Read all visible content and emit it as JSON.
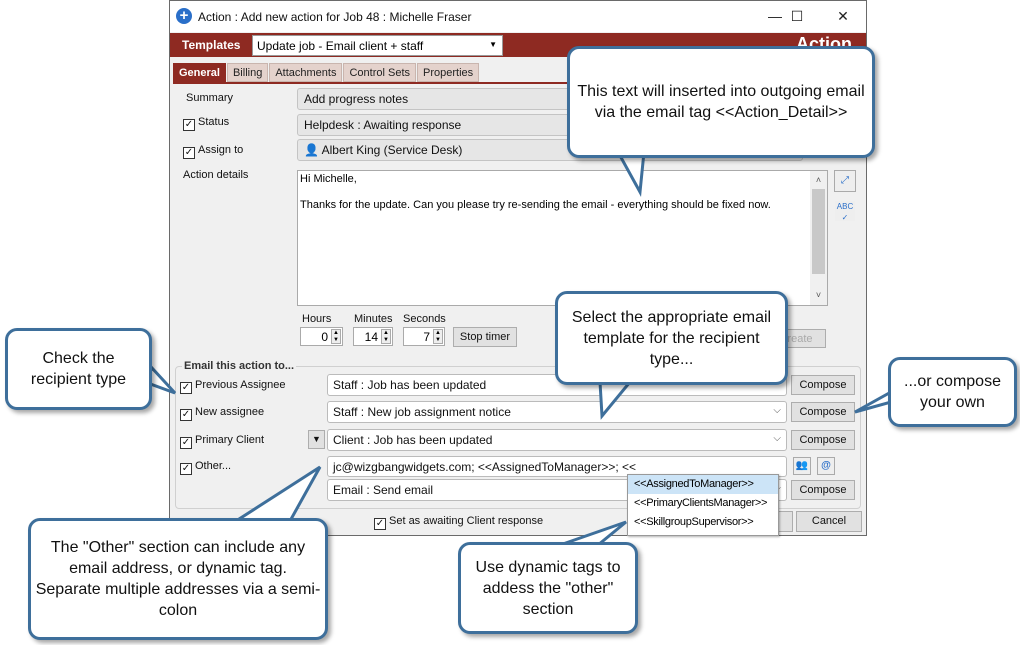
{
  "window": {
    "title": "Action : Add new action for Job 48 : Michelle Fraser",
    "controls": {
      "minimize": "—",
      "maximize": "☐",
      "close": "✕"
    }
  },
  "header": {
    "templates_label": "Templates",
    "template_value": "Update job - Email client + staff",
    "brand": "Action",
    "brand_color": "#8e2a22"
  },
  "tabs": [
    {
      "label": "General",
      "active": true
    },
    {
      "label": "Billing"
    },
    {
      "label": "Attachments"
    },
    {
      "label": "Control Sets"
    },
    {
      "label": "Properties"
    }
  ],
  "form": {
    "summary_label": "Summary",
    "summary_value": "Add progress notes",
    "status_label": "Status",
    "status_checked": true,
    "status_value": "Helpdesk : Awaiting response",
    "assign_label": "Assign to",
    "assign_checked": true,
    "assign_value": "Albert King (Service Desk)",
    "details_label": "Action details",
    "details_lines": [
      "Hi Michelle,",
      "",
      "Thanks for the update.   Can you please try re-sending the email - everything should be fixed now."
    ],
    "hours_label": "Hours",
    "hours_value": "0",
    "minutes_label": "Minutes",
    "minutes_value": "14",
    "seconds_label": "Seconds",
    "seconds_value": "7",
    "stop_timer": "Stop timer",
    "create": "Create"
  },
  "email": {
    "group_label": "Email this action to...",
    "rows": [
      {
        "label": "Previous Assignee",
        "checked": true,
        "template": "Staff : Job has been updated",
        "button": "Compose"
      },
      {
        "label": "New assignee",
        "checked": true,
        "template": "Staff : New job assignment notice",
        "button": "Compose"
      },
      {
        "label": "Primary Client",
        "checked": true,
        "template": "Client : Job has been updated",
        "button": "Compose"
      },
      {
        "label": "Other...",
        "checked": true,
        "address": "jc@wizgbangwidgets.com; <<AssignedToManager>>; <<",
        "template": "Email : Send email",
        "button": "Compose"
      }
    ],
    "awaiting_label": "Set as awaiting Client response",
    "awaiting_checked": true,
    "cancel": "Cancel",
    "tag_options": [
      "<<AssignedToManager>>",
      "<<PrimaryClientsManager>>",
      "<<SkillgroupSupervisor>>"
    ],
    "tag_selected": "<<AssignedToManager>>"
  },
  "callouts": {
    "detail_tag": "This text will inserted into outgoing email via the email tag <<Action_Detail>>",
    "select_template": "Select the appropriate email template for the recipient type...",
    "check_recipient": "Check the recipient type",
    "compose_own": "...or compose your own",
    "other_section": "The \"Other\" section can include any email address, or dynamic tag.  Separate multiple addresses via a semi-colon",
    "dynamic_tags": "Use dynamic tags to addess the \"other\" section",
    "border_color": "#3e6f9b"
  }
}
